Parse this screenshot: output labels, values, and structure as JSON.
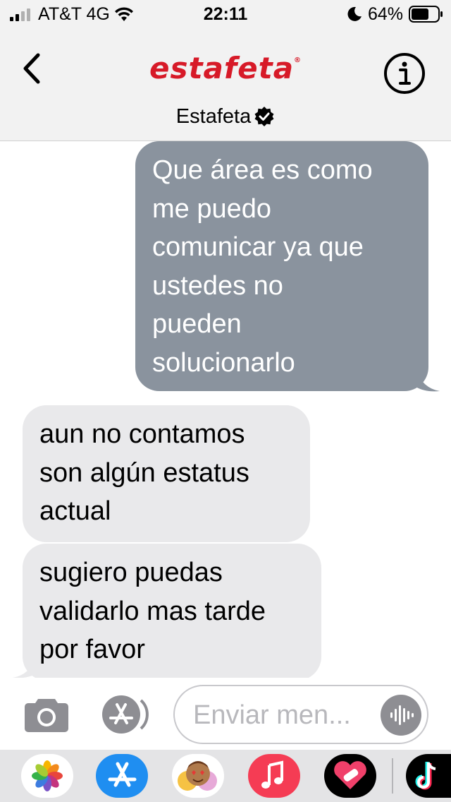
{
  "status_bar": {
    "carrier": "AT&T 4G",
    "time": "22:11",
    "battery": "64%"
  },
  "header": {
    "logo": "estafeta",
    "contact_name": "Estafeta"
  },
  "messages": [
    {
      "direction": "sent",
      "text": "Que área es como me puedo comunicar ya que ustedes no pueden solucionarlo",
      "lines": [
        "Que área es como",
        "me puedo",
        "comunicar ya que",
        "ustedes no",
        "pueden",
        "solucionarlo"
      ]
    },
    {
      "direction": "received",
      "text": "aun no contamos son algún estatus actual",
      "lines": [
        "aun no contamos",
        "son algún estatus",
        "actual"
      ]
    },
    {
      "direction": "received",
      "text": "sugiero puedas validarlo mas tarde por favor",
      "lines": [
        "sugiero puedas",
        "validarlo mas tarde",
        "por favor"
      ]
    }
  ],
  "input": {
    "placeholder": "Enviar men..."
  },
  "icons": {
    "back": "chevron-left-icon",
    "info": "info-icon",
    "verified": "verified-badge-icon",
    "camera": "camera-icon",
    "appstore": "app-store-icon",
    "audio": "audio-waveform-icon"
  },
  "dock": [
    "photos-app",
    "app-store-app",
    "memoji-app",
    "music-app",
    "fitness-heart-app",
    "tiktok-app"
  ],
  "colors": {
    "sent_bubble": "#8a939e",
    "received_bubble": "#e9e9eb",
    "logo_red": "#d71a28"
  }
}
